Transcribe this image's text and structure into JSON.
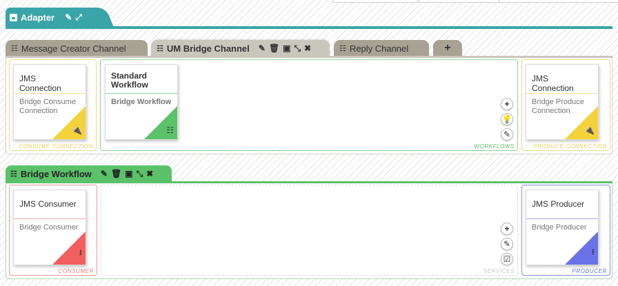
{
  "adapter": {
    "tab_label": "Adapter",
    "icons": [
      "adapter-icon",
      "edit-icon",
      "expand-icon"
    ]
  },
  "channel_tabs": [
    {
      "label": "Message Creator Channel",
      "active": false
    },
    {
      "label": "UM Bridge Channel",
      "active": true
    },
    {
      "label": "Reply Channel",
      "active": false
    },
    {
      "label": "+",
      "active": false
    }
  ],
  "channel": {
    "consume": {
      "zone_label": "CONSUME CONNECTION",
      "card_title": "JMS Connection",
      "card_subtitle": "Bridge Consume Connection",
      "color": "#f5d23a",
      "corner_icon": "plug-icon"
    },
    "workflows": {
      "zone_label": "WORKFLOWS",
      "card_title": "Standard Workflow",
      "card_subtitle": "Bridge Workflow",
      "color": "#5cc26a",
      "corner_icon": "workflow-icon",
      "buttons": [
        "add-icon",
        "lightbulb-icon",
        "edit-icon"
      ]
    },
    "produce": {
      "zone_label": "PRODUCE CONNECTION",
      "card_title": "JMS Connection",
      "card_subtitle": "Bridge Produce Connection",
      "color": "#f5d23a",
      "corner_icon": "plug-icon"
    }
  },
  "workflow": {
    "tab_label": "Bridge Workflow",
    "consumer": {
      "zone_label": "CONSUMER",
      "card_title": "JMS Consumer",
      "card_subtitle": "Bridge Consumer",
      "color": "#f25f5f",
      "corner_icon": "download-icon"
    },
    "services": {
      "zone_label": "SERVICES",
      "buttons": [
        "add-icon",
        "edit-icon",
        "checkbox-icon"
      ]
    },
    "producer": {
      "zone_label": "PRODUCER",
      "card_title": "JMS Producer",
      "card_subtitle": "Bridge Producer",
      "color": "#6a72e8",
      "corner_icon": "upload-icon"
    }
  },
  "colors": {
    "adapter_accent": "#3aa5a9",
    "channel_tab": "#a8a294",
    "channel_tab_active": "#c9c6bc",
    "workflow_accent": "#5cc26a",
    "consume_border": "#e8dc86",
    "workflow_border": "#8fd394",
    "consumer_border": "#ee9a9a",
    "producer_border": "#8a8ee8"
  }
}
